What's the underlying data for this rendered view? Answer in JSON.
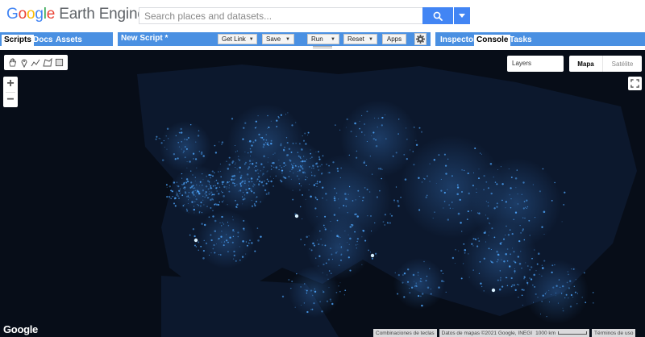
{
  "header": {
    "logo": {
      "google_letters": [
        "G",
        "o",
        "o",
        "g",
        "l",
        "e"
      ],
      "product": "Earth Engine"
    },
    "search": {
      "placeholder": "Search places and datasets..."
    },
    "icons": {
      "search": "search-icon",
      "dropdown": "caret-down-icon"
    },
    "accent_color": "#4285f4"
  },
  "left_panel": {
    "tabs": [
      {
        "label": "Scripts",
        "active": true
      },
      {
        "label": "Docs",
        "active": false
      },
      {
        "label": "Assets",
        "active": false
      }
    ]
  },
  "editor": {
    "script_name": "New Script *",
    "buttons": {
      "get_link": "Get Link",
      "save": "Save",
      "run": "Run",
      "reset": "Reset",
      "apps": "Apps"
    },
    "settings_icon": "gear-icon"
  },
  "right_panel": {
    "tabs": [
      {
        "label": "Inspector",
        "active": false
      },
      {
        "label": "Console",
        "active": true
      },
      {
        "label": "Tasks",
        "active": false
      }
    ]
  },
  "map": {
    "draw_tools": [
      "hand-icon",
      "marker-icon",
      "polyline-icon",
      "polygon-icon",
      "rectangle-icon"
    ],
    "zoom_in": "+",
    "zoom_out": "−",
    "layers_label": "Layers",
    "map_type": {
      "map": "Mapa",
      "satellite": "Satélite",
      "selected": "Mapa"
    },
    "fullscreen_icon": "fullscreen-icon",
    "watermark": "Google",
    "footer": {
      "shortcuts": "Combinaciones de teclas",
      "attribution": "Datos de mapas ©2021 Google, INEGI",
      "scale": "1000 km",
      "terms": "Términos de uso"
    },
    "background_color": "#070d18",
    "light_color": "#4a9df0"
  }
}
